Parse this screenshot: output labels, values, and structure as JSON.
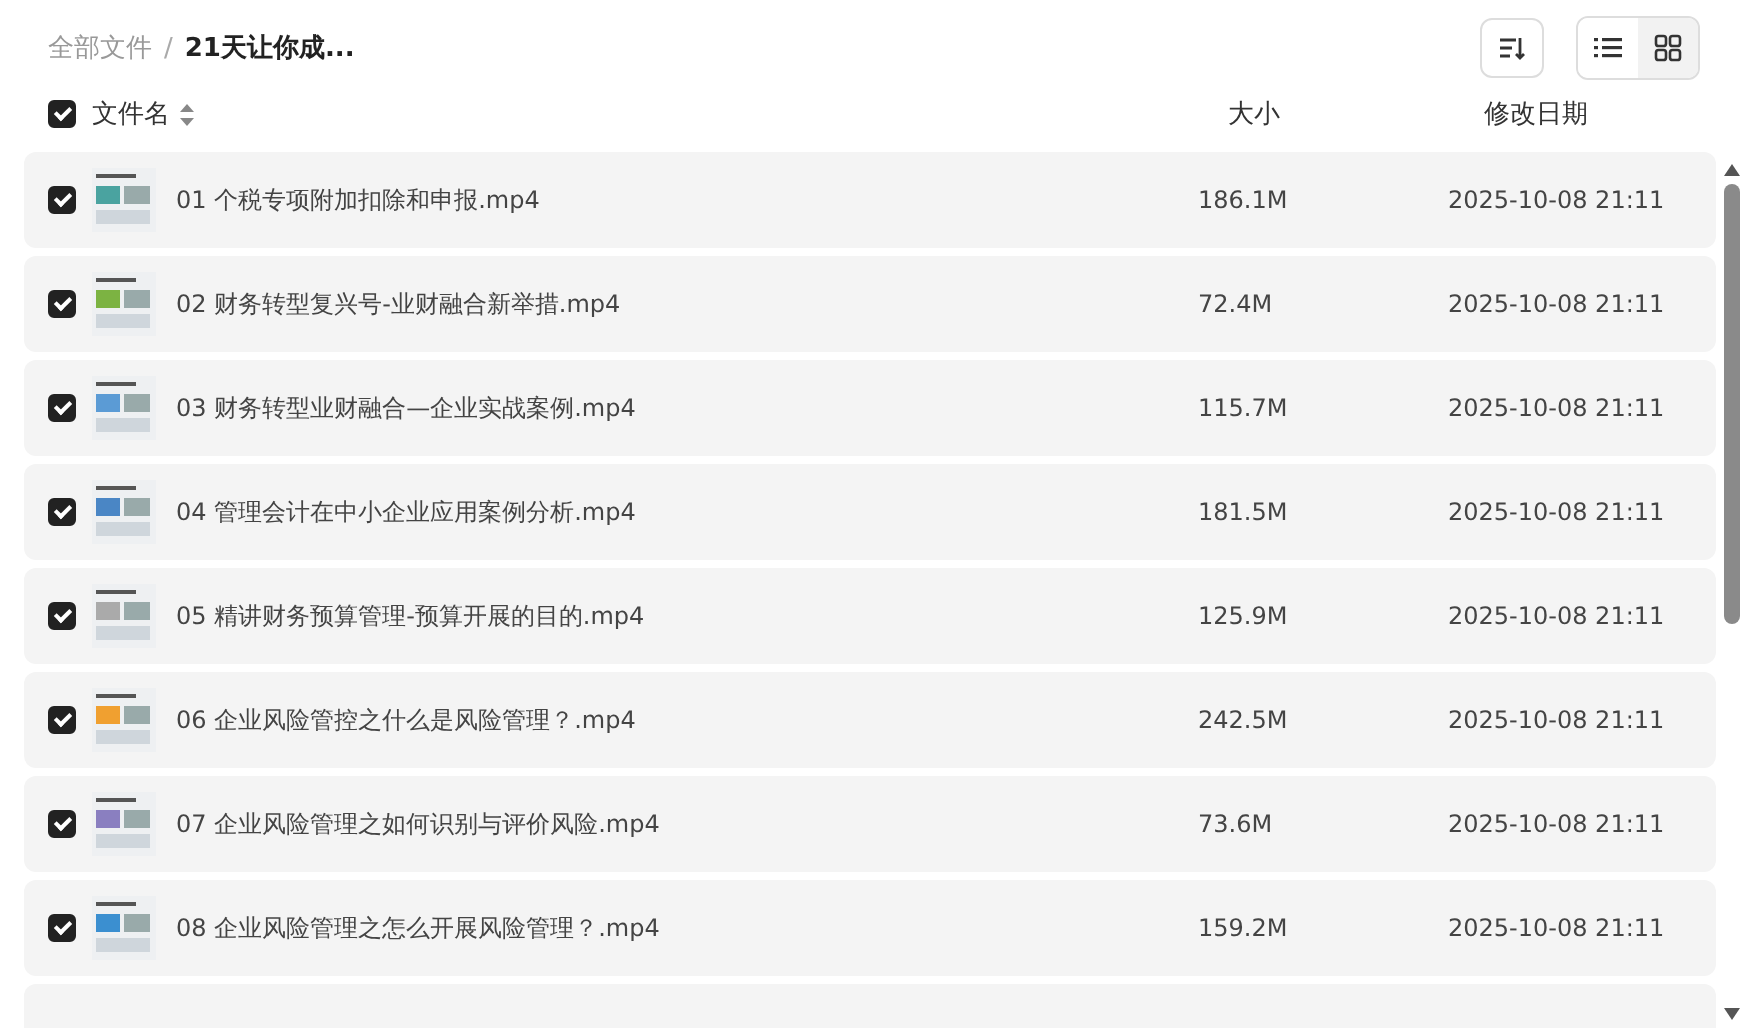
{
  "breadcrumb": [
    {
      "label": "全部文件"
    },
    {
      "label": "21天让你成..."
    }
  ],
  "breadcrumb_separator": "/",
  "view_modes": [
    {
      "kind": "list",
      "selected": false
    },
    {
      "kind": "grid",
      "selected": true
    }
  ],
  "table": {
    "select_all": {
      "checked": true
    },
    "columns": [
      "文件名",
      "大小",
      "修改日期"
    ],
    "rows": [
      {
        "name": "01 个税专项附加扣除和申报.mp4",
        "size": "186.1M",
        "modified": "2025-10-08 21:11",
        "checked": true
      },
      {
        "name": "02 财务转型复兴号-业财融合新举措.mp4",
        "size": "72.4M",
        "modified": "2025-10-08 21:11",
        "checked": true
      },
      {
        "name": "03 财务转型业财融合—企业实战案例.mp4",
        "size": "115.7M",
        "modified": "2025-10-08 21:11",
        "checked": true
      },
      {
        "name": "04 管理会计在中小企业应用案例分析.mp4",
        "size": "181.5M",
        "modified": "2025-10-08 21:11",
        "checked": true
      },
      {
        "name": "05 精讲财务预算管理-预算开展的目的.mp4",
        "size": "125.9M",
        "modified": "2025-10-08 21:11",
        "checked": true
      },
      {
        "name": "06 企业风险管控之什么是风险管理？.mp4",
        "size": "242.5M",
        "modified": "2025-10-08 21:11",
        "checked": true
      },
      {
        "name": "07 企业风险管理之如何识别与评价风险.mp4",
        "size": "73.6M",
        "modified": "2025-10-08 21:11",
        "checked": true
      },
      {
        "name": "08 企业风险管理之怎么开展风险管理？.mp4",
        "size": "159.2M",
        "modified": "2025-10-08 21:11",
        "checked": true
      }
    ]
  }
}
